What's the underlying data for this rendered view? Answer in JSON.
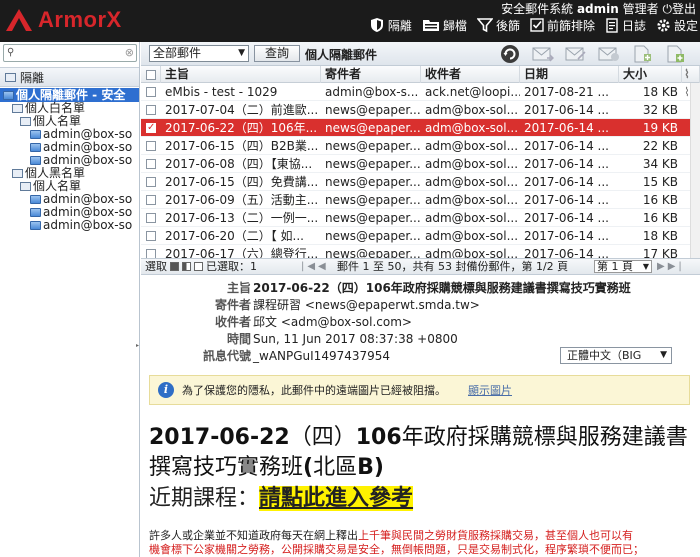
{
  "header": {
    "logo_text": "ArmorX",
    "system_name": "安全郵件系統",
    "username": "admin",
    "role": "管理者",
    "logout": "登出",
    "nav": [
      {
        "label": "隔離",
        "icon": "shield-icon"
      },
      {
        "label": "歸檔",
        "icon": "archive-folder-icon"
      },
      {
        "label": "後篩",
        "icon": "filter-icon"
      },
      {
        "label": "前篩排除",
        "icon": "checkbox-icon"
      },
      {
        "label": "日誌",
        "icon": "log-book-icon"
      },
      {
        "label": "設定",
        "icon": "gear-icon"
      }
    ]
  },
  "sidebar": {
    "search_placeholder": "",
    "section_label": "隔離",
    "tree": [
      {
        "label": "個人隔離郵件 - 安全",
        "level": 0,
        "selected": true,
        "icon": "mail-folder-icon"
      },
      {
        "label": "個人白名單",
        "level": 1,
        "icon": "folder-icon"
      },
      {
        "label": "個人名單",
        "level": 2,
        "icon": "folder-icon"
      },
      {
        "label": "admin@box-so",
        "level": 3,
        "icon": "mail-icon"
      },
      {
        "label": "admin@box-so",
        "level": 3,
        "icon": "mail-icon"
      },
      {
        "label": "admin@box-so",
        "level": 3,
        "icon": "mail-icon"
      },
      {
        "label": "個人黑名單",
        "level": 1,
        "icon": "folder-icon"
      },
      {
        "label": "個人名單",
        "level": 2,
        "icon": "folder-icon"
      },
      {
        "label": "admin@box-so",
        "level": 3,
        "icon": "mail-icon"
      },
      {
        "label": "admin@box-so",
        "level": 3,
        "icon": "mail-icon"
      },
      {
        "label": "admin@box-so",
        "level": 3,
        "icon": "mail-icon"
      }
    ]
  },
  "toolbar": {
    "filter_value": "全部郵件",
    "query_label": "查詢",
    "folder_title": "個人隔離郵件"
  },
  "mail_list": {
    "columns": {
      "subject": "主旨",
      "from": "寄件者",
      "to": "收件者",
      "date": "日期",
      "size": "大小"
    },
    "rows": [
      {
        "subject": "eMbis - test - 1029",
        "from": "admin@box-s...",
        "to": "ack.net@loopi...",
        "date": "2017-08-21 ...",
        "size": "18 KB",
        "attach": true,
        "selected": false
      },
      {
        "subject": "2017-07-04（二）前進歐...",
        "from": "news@epaper...",
        "to": "adm@box-sol...",
        "date": "2017-06-14 ...",
        "size": "32 KB",
        "attach": false,
        "selected": false
      },
      {
        "subject": "2017-06-22（四）106年...",
        "from": "news@epaper...",
        "to": "adm@box-sol...",
        "date": "2017-06-14 ...",
        "size": "19 KB",
        "attach": false,
        "selected": true
      },
      {
        "subject": "2017-06-15（四）B2B業...",
        "from": "news@epaper...",
        "to": "adm@box-sol...",
        "date": "2017-06-14 ...",
        "size": "22 KB",
        "attach": false,
        "selected": false
      },
      {
        "subject": "2017-06-08（四）【東協...",
        "from": "news@epaper...",
        "to": "adm@box-sol...",
        "date": "2017-06-14 ...",
        "size": "34 KB",
        "attach": false,
        "selected": false
      },
      {
        "subject": "2017-06-15（四）免費講...",
        "from": "news@epaper...",
        "to": "adm@box-sol...",
        "date": "2017-06-14 ...",
        "size": "15 KB",
        "attach": false,
        "selected": false
      },
      {
        "subject": "2017-06-09（五）活動主...",
        "from": "news@epaper...",
        "to": "adm@box-sol...",
        "date": "2017-06-14 ...",
        "size": "16 KB",
        "attach": false,
        "selected": false
      },
      {
        "subject": "2017-06-13（二）一例一...",
        "from": "news@epaper...",
        "to": "adm@box-sol...",
        "date": "2017-06-14 ...",
        "size": "16 KB",
        "attach": false,
        "selected": false
      },
      {
        "subject": "2017-06-20（二）【 如...",
        "from": "news@epaper...",
        "to": "adm@box-sol...",
        "date": "2017-06-14 ...",
        "size": "18 KB",
        "attach": false,
        "selected": false
      },
      {
        "subject": "2017-06-17（六）總登行...",
        "from": "news@epaper...",
        "to": "adm@box-sol...",
        "date": "2017-06-14 ...",
        "size": "17 KB",
        "attach": false,
        "selected": false
      }
    ]
  },
  "pager": {
    "select_label": "選取",
    "selected_label": "已選取：1",
    "info": "郵件 1 至 50，共有 53 封備份郵件，第 1/2 頁",
    "page_value": "第 1 頁"
  },
  "preview": {
    "subject_label": "主旨",
    "subject": "2017-06-22（四）106年政府採購競標與服務建議書撰寫技巧實務班",
    "from_label": "寄件者",
    "from": "課程研習 <news@epaperwt.smda.tw>",
    "to_label": "收件者",
    "to": "邱文 <adm@box-sol.com>",
    "time_label": "時間",
    "time": "Sun, 11 Jun 2017 08:37:38 +0800",
    "msgid_label": "訊息代號",
    "msgid": "_wANPGuI1497437954",
    "charset": "正體中文（BIG",
    "notice": "為了保護您的隱私，此郵件中的遠端圖片已經被阻擋。",
    "notice_link": "顯示圖片",
    "body_title_date": "2017-06-22",
    "body_title_weekday": "（四）",
    "body_title_year": "106",
    "body_title_rest": "年政府採購競標與服務建議書撰寫技巧實務班",
    "body_title_paren_open": "(",
    "body_title_region": "北區",
    "body_title_region_b": "B",
    "body_title_paren_close": ")",
    "body_course_label": "近期課程：",
    "body_course_link": "請點此進入參考",
    "body_para_1": "許多人或企業並不知道政府每天在網上釋出",
    "body_para_red": "上千筆與民間之勞財貨服務採購交易，甚至個人也可以有",
    "body_para_2": "機會標下公家機關之勞務，公開採購交易是安全，無倒帳問題，只是交易制式化，程序繁瑣不便而已；"
  }
}
